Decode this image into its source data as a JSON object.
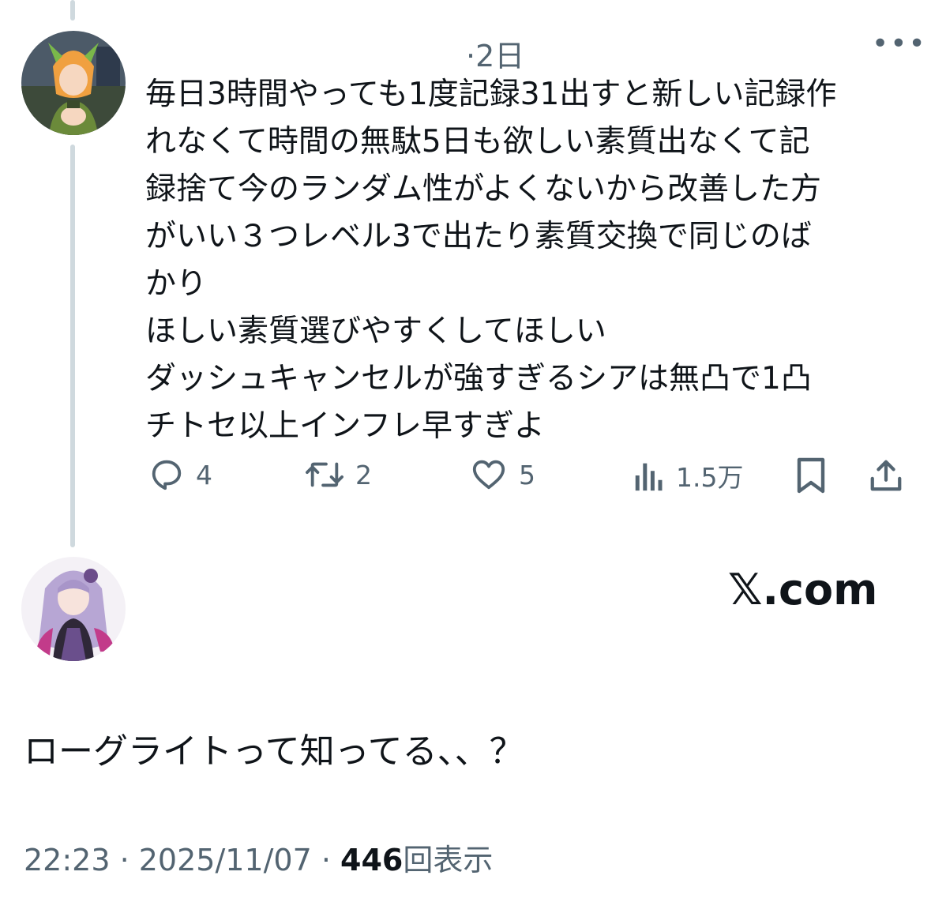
{
  "tweet": {
    "time": "·2日",
    "more": "•••",
    "lines": [
      "毎日3時間やっても1度記録31出すと新しい記録作",
      "れなくて時間の無駄5日も欲しい素質出なくて記",
      "録捨て今のランダム性がよくないから改善した方",
      "がいい３つレベル3で出たり素質交換で同じのば",
      "かり",
      "ほしい素質選びやすくしてほしい",
      "ダッシュキャンセルが強すぎるシアは無凸で1凸",
      "チトセ以上インフレ早すぎよ"
    ],
    "actions": {
      "reply_count": "4",
      "retweet_count": "2",
      "like_count": "5",
      "views_count": "1.5万"
    }
  },
  "watermark": "𝕏.com",
  "reply": {
    "text": "ローグライトって知ってる、、？",
    "timestamp": "22:23 · 2025/11/07 · ",
    "views_number": "446",
    "views_label": "回表示"
  },
  "icons": [
    "reply-icon",
    "retweet-icon",
    "like-icon",
    "views-icon",
    "bookmark-icon",
    "share-icon",
    "more-icon"
  ],
  "colors": {
    "secondary_text": "#536471",
    "thread_line": "#cfd9de",
    "text": "#0f1419"
  }
}
